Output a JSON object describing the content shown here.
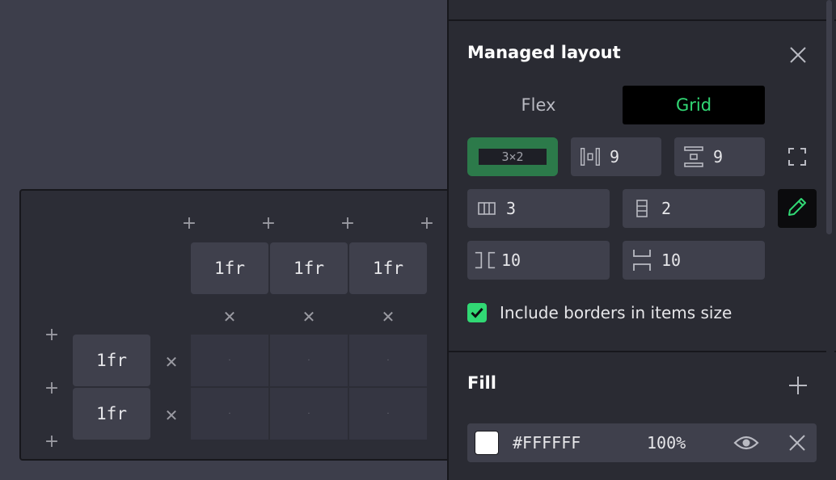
{
  "layout_panel": {
    "title": "Managed layout",
    "tabs": [
      {
        "label": "Flex",
        "active": false
      },
      {
        "label": "Grid",
        "active": true
      }
    ],
    "preset_label": "3×2",
    "column_gap": "9",
    "row_gap": "9",
    "columns": "3",
    "rows": "2",
    "padding_horizontal": "10",
    "padding_vertical": "10",
    "include_borders_label": "Include borders in items size",
    "include_borders_checked": true
  },
  "fill_panel": {
    "title": "Fill",
    "color_hex": "#FFFFFF",
    "opacity": "100%",
    "swatch_color": "#FFFFFF"
  },
  "grid_editor": {
    "columns": [
      "1fr",
      "1fr",
      "1fr"
    ],
    "rows": [
      "1fr",
      "1fr"
    ],
    "cell_dot": "·"
  },
  "colors": {
    "accent_green": "#31d874",
    "preset_bg": "#2c7a4a",
    "panel_bg": "#2a2b33",
    "canvas_bg": "#3d3e4b"
  }
}
